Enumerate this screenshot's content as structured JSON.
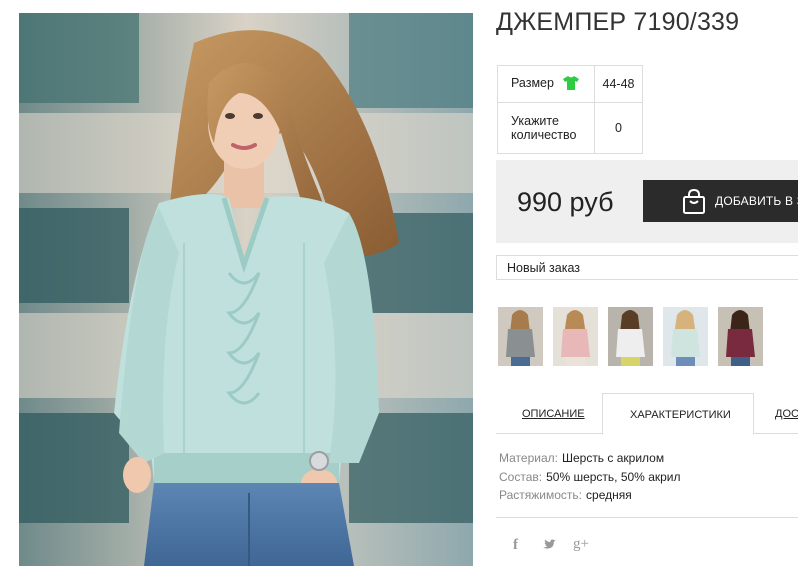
{
  "product": {
    "title": "ДЖЕМПЕР 7190/339"
  },
  "options": {
    "size_label": "Размер",
    "size_value": "44-48",
    "qty_label_line1": "Укажите",
    "qty_label_line2": "количество",
    "qty_value": "0"
  },
  "purchase": {
    "price": "990 руб",
    "add_button_label": "ДОБАВИТЬ В ЗАКАЗ",
    "order_select_value": "Новый заказ"
  },
  "thumbnails": [
    {
      "name": "thumb-grey",
      "color": "#8a8f92"
    },
    {
      "name": "thumb-pink",
      "color": "#e8b8b9"
    },
    {
      "name": "thumb-white",
      "color": "#eeeeee"
    },
    {
      "name": "thumb-mint",
      "color": "#cfe3df"
    },
    {
      "name": "thumb-burgundy",
      "color": "#7a2a3e"
    }
  ],
  "tabs": [
    {
      "label": "ОПИСАНИЕ",
      "active": false
    },
    {
      "label": "ХАРАКТЕРИСТИКИ",
      "active": true
    },
    {
      "label": "ДОС",
      "active": false
    }
  ],
  "specs": [
    {
      "key": "Материал:",
      "value": "Шерсть с акрилом"
    },
    {
      "key": "Состав:",
      "value": "50% шерсть, 50% акрил"
    },
    {
      "key": "Растяжимость:",
      "value": "средняя"
    }
  ],
  "social": {
    "facebook": "f",
    "twitter": "twitter-icon",
    "google_plus": "g+"
  },
  "colors": {
    "button_bg": "#2b2b2b",
    "price_box_bg": "#efefef",
    "size_icon": "#2ecc40",
    "sweater": "#bfe0dc"
  }
}
